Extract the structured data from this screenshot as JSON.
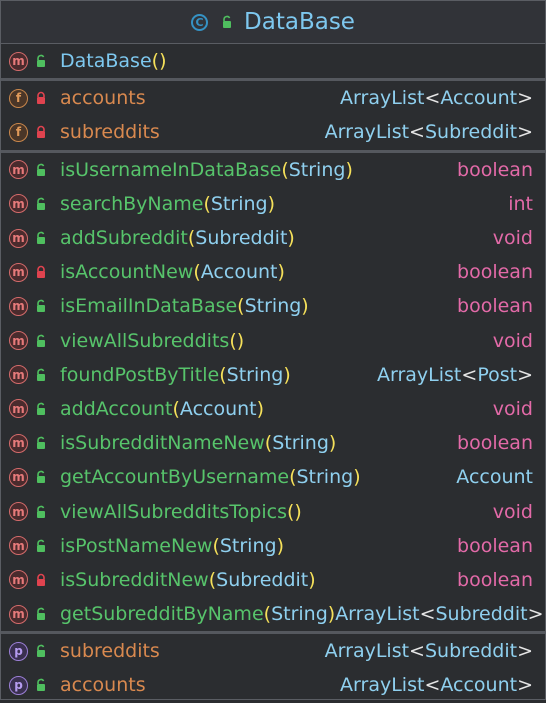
{
  "header": {
    "title": "DataBase",
    "icon": "class-icon",
    "visibility": "public"
  },
  "constructors": [
    {
      "kind": "m",
      "name": "DataBase",
      "params": "",
      "visibility": "public"
    }
  ],
  "fields": [
    {
      "kind": "f",
      "name": "accounts",
      "type_outer": "ArrayList",
      "type_inner": "Account",
      "visibility": "private"
    },
    {
      "kind": "f",
      "name": "subreddits",
      "type_outer": "ArrayList",
      "type_inner": "Subreddit",
      "visibility": "private"
    }
  ],
  "methods": [
    {
      "kind": "m",
      "name": "isUsernameInDataBase",
      "params": "String",
      "type": "boolean",
      "type_class": "kw",
      "visibility": "public"
    },
    {
      "kind": "m",
      "name": "searchByName",
      "params": "String",
      "type": "int",
      "type_class": "kw",
      "visibility": "public"
    },
    {
      "kind": "m",
      "name": "addSubreddit",
      "params": "Subreddit",
      "type": "void",
      "type_class": "kw",
      "visibility": "public"
    },
    {
      "kind": "m",
      "name": "isAccountNew",
      "params": "Account",
      "type": "boolean",
      "type_class": "kw",
      "visibility": "private"
    },
    {
      "kind": "m",
      "name": "isEmailInDataBase",
      "params": "String",
      "type": "boolean",
      "type_class": "kw",
      "visibility": "public"
    },
    {
      "kind": "m",
      "name": "viewAllSubreddits",
      "params": "",
      "type": "void",
      "type_class": "kw",
      "visibility": "public"
    },
    {
      "kind": "m",
      "name": "foundPostByTitle",
      "params": "String",
      "type_outer": "ArrayList",
      "type_inner": "Post",
      "visibility": "public"
    },
    {
      "kind": "m",
      "name": "addAccount",
      "params": "Account",
      "type": "void",
      "type_class": "kw",
      "visibility": "public"
    },
    {
      "kind": "m",
      "name": "isSubredditNameNew",
      "params": "String",
      "type": "boolean",
      "type_class": "kw",
      "visibility": "public"
    },
    {
      "kind": "m",
      "name": "getAccountByUsername",
      "params": "String",
      "type": "Account",
      "type_class": "cls",
      "visibility": "public"
    },
    {
      "kind": "m",
      "name": "viewAllSubredditsTopics",
      "params": "",
      "type": "void",
      "type_class": "kw",
      "visibility": "public"
    },
    {
      "kind": "m",
      "name": "isPostNameNew",
      "params": "String",
      "type": "boolean",
      "type_class": "kw",
      "visibility": "public"
    },
    {
      "kind": "m",
      "name": "isSubredditNew",
      "params": "Subreddit",
      "type": "boolean",
      "type_class": "kw",
      "visibility": "private"
    },
    {
      "kind": "m",
      "name": "getSubredditByName",
      "params": "String",
      "type_outer": "ArrayList",
      "type_inner": "Subreddit",
      "visibility": "public"
    }
  ],
  "properties": [
    {
      "kind": "p",
      "name": "subreddits",
      "type_outer": "ArrayList",
      "type_inner": "Subreddit",
      "visibility": "public"
    },
    {
      "kind": "p",
      "name": "accounts",
      "type_outer": "ArrayList",
      "type_inner": "Account",
      "visibility": "public"
    }
  ],
  "colors": {
    "method": "#d36a6a",
    "field": "#c8864b",
    "property": "#9b7fd6",
    "public": "#4fbf5f",
    "private": "#e0434f"
  }
}
